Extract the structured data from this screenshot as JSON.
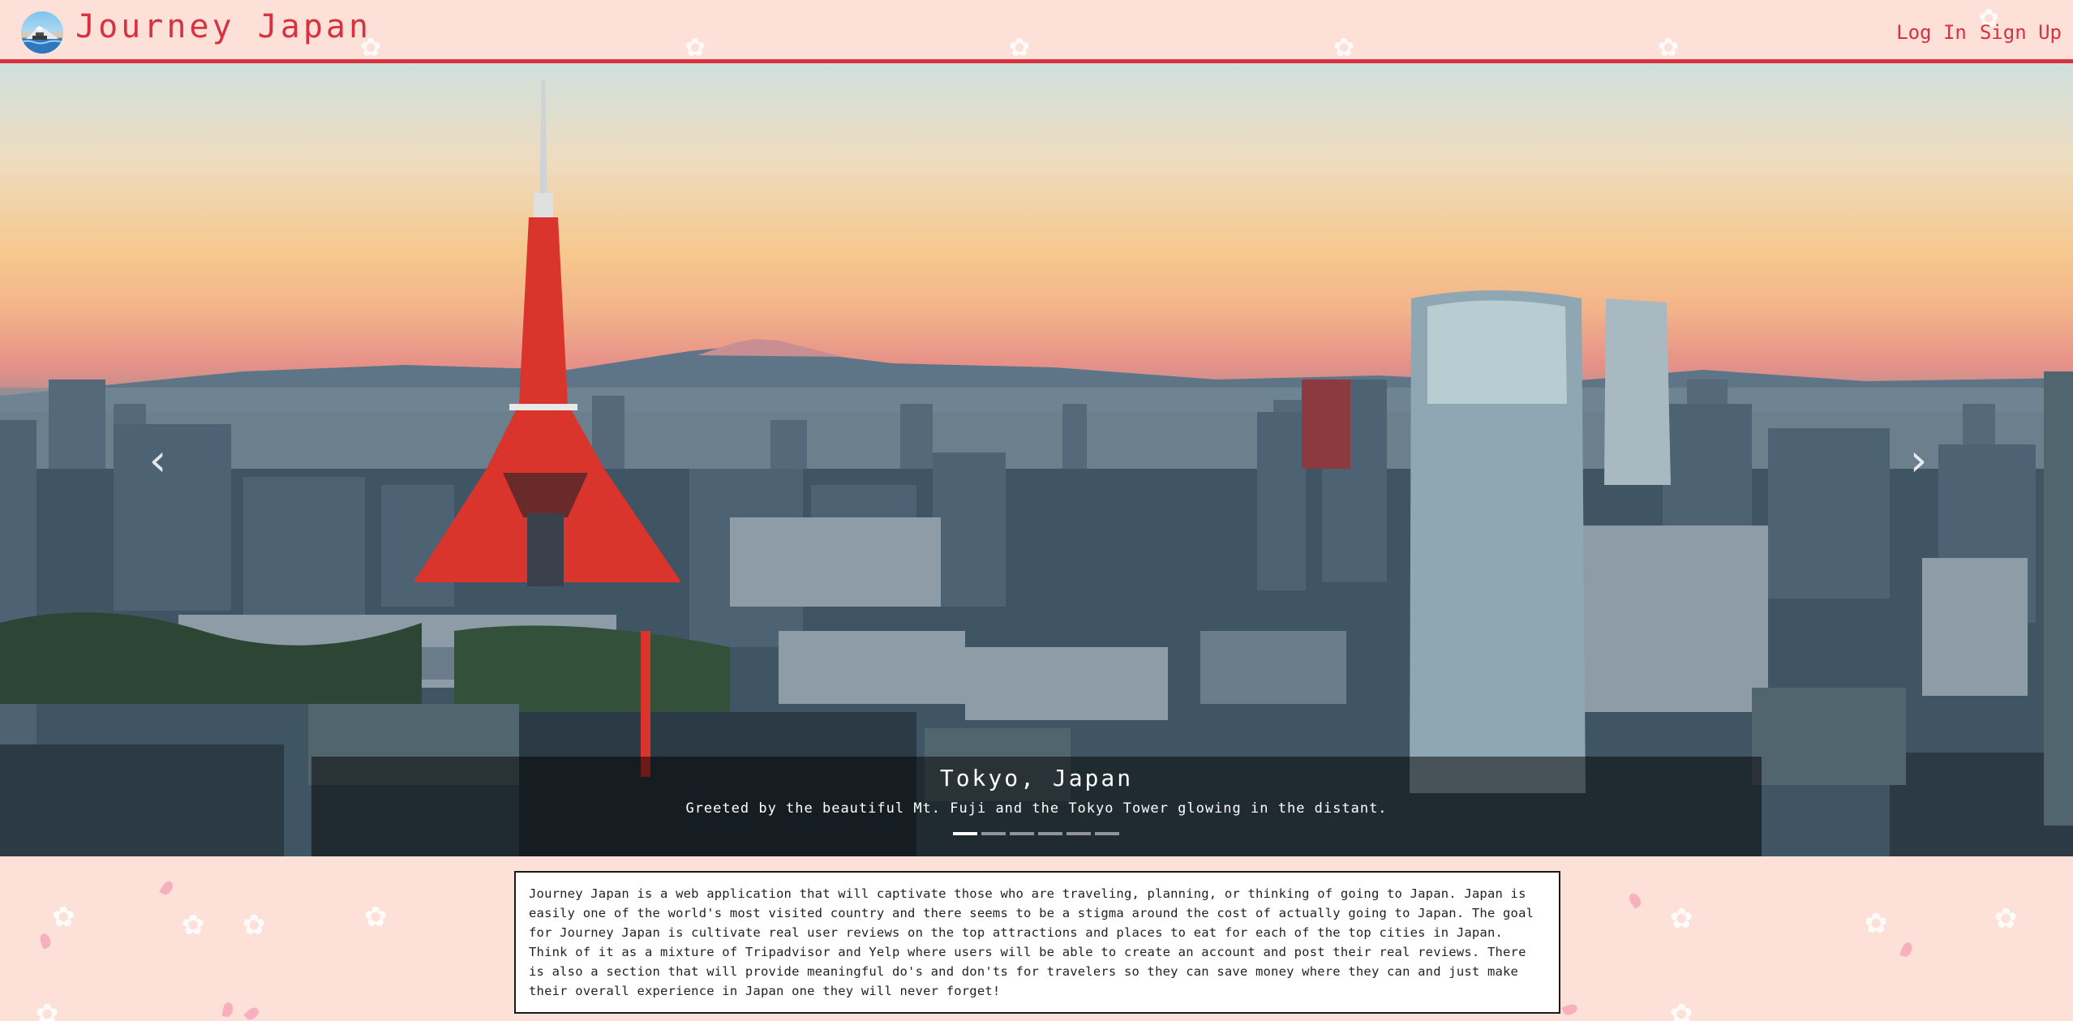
{
  "header": {
    "brand_title": "Journey Japan",
    "nav": {
      "login_label": "Log In",
      "signup_label": "Sign Up"
    }
  },
  "carousel": {
    "slide_title": "Tokyo, Japan",
    "slide_caption": "Greeted by the beautiful Mt. Fuji and the Tokyo Tower glowing in the distant.",
    "prev_icon": "chevron-left-icon",
    "next_icon": "chevron-right-icon",
    "slide_count": 6,
    "active_slide": 1
  },
  "about": {
    "text": "Journey Japan is a web application that will captivate those who are traveling, planning, or thinking of going to Japan. Japan is easily one of the world's most visited country and there seems to be a stigma around the cost of actually going to Japan. The goal for Journey Japan is cultivate real user reviews on the top attractions and places to eat for each of the top cities in Japan. Think of it as a mixture of Tripadvisor and Yelp where users will be able to create an account and post their real reviews. There is also a section that will provide meaningful do's and don'ts for travelers so they can save money where they can and just make their overall experience in Japan one they will never forget!"
  },
  "colors": {
    "accent": "#d8313f",
    "page_background": "#fde1d9",
    "tower_red": "#d9352c"
  }
}
